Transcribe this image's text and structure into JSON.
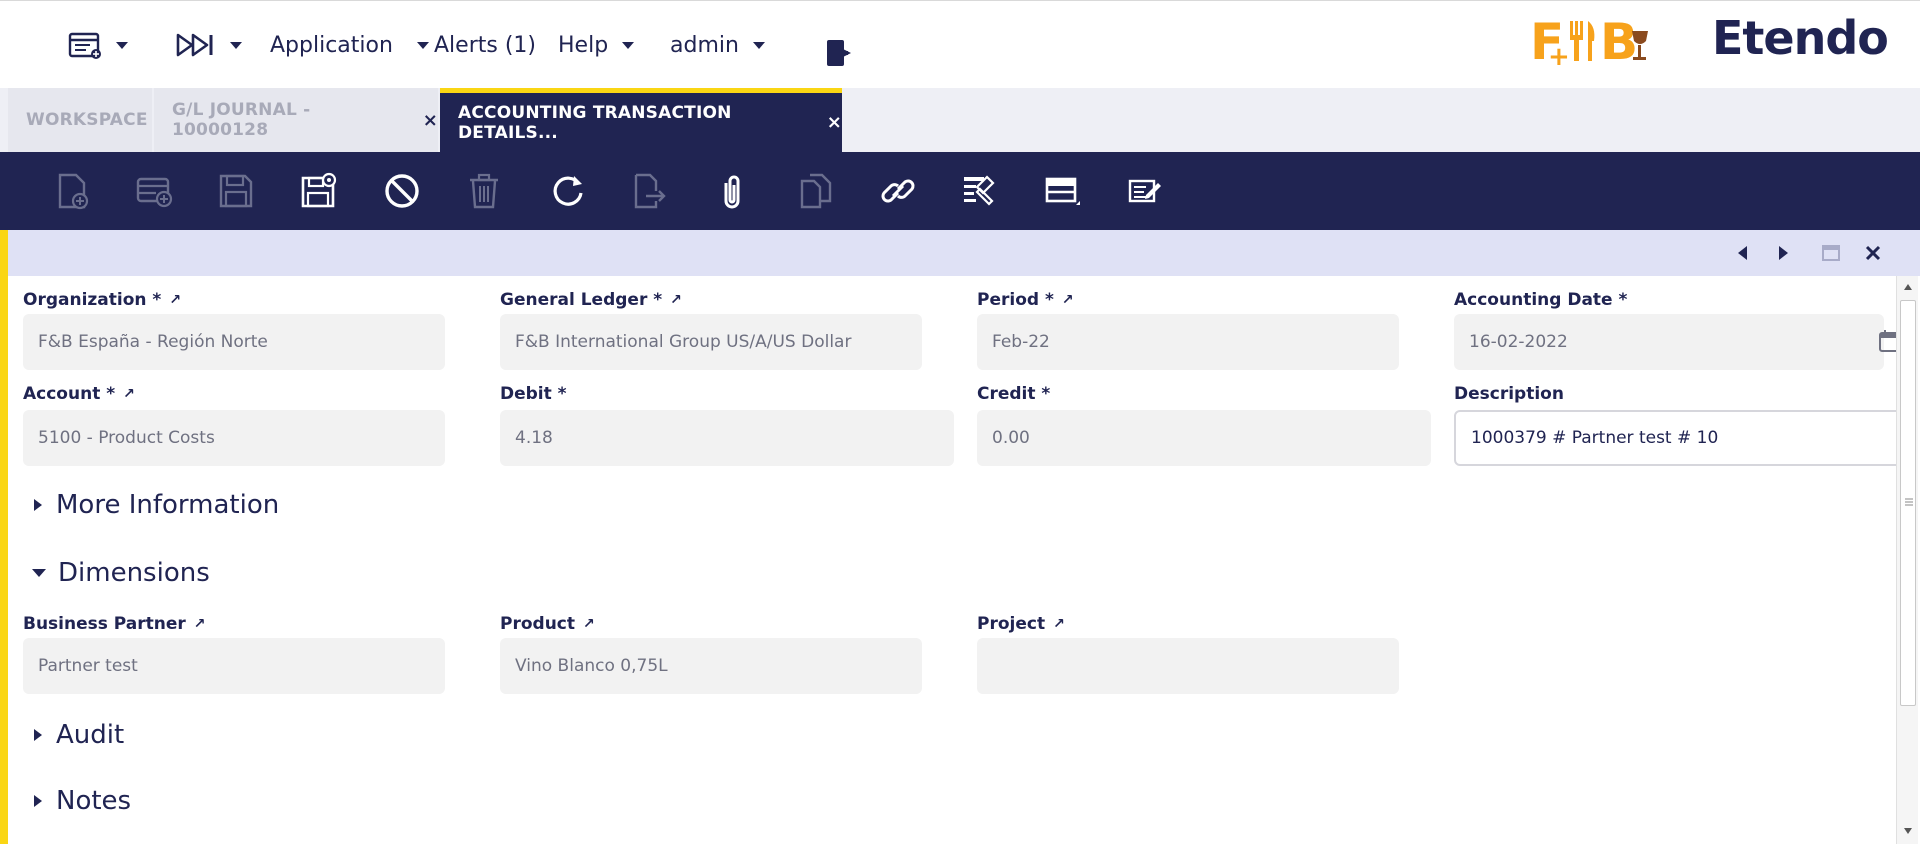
{
  "topnav": {
    "application": "Application",
    "alerts": "Alerts (1)",
    "help": "Help",
    "user": "admin",
    "logo_fb": "F+B",
    "logo_etendo": "Etendo"
  },
  "tabs": [
    {
      "label": "WORKSPACE"
    },
    {
      "label": "G/L JOURNAL - 10000128",
      "close": "×"
    },
    {
      "label": "ACCOUNTING TRANSACTION DETAILS...",
      "close": "×"
    }
  ],
  "form": {
    "organization": {
      "label": "Organization *",
      "value": "F&B España - Región Norte"
    },
    "general_ledger": {
      "label": "General Ledger *",
      "value": "F&B International Group US/A/US Dollar"
    },
    "period": {
      "label": "Period *",
      "value": "Feb-22"
    },
    "accounting_date": {
      "label": "Accounting Date *",
      "value": "16-02-2022"
    },
    "account": {
      "label": "Account *",
      "value": "5100 - Product Costs"
    },
    "debit": {
      "label": "Debit *",
      "value": "4.18"
    },
    "credit": {
      "label": "Credit *",
      "value": "0.00"
    },
    "description": {
      "label": "Description",
      "value": "1000379 # Partner test # 10"
    },
    "business_partner": {
      "label": "Business Partner",
      "value": "Partner test"
    },
    "product": {
      "label": "Product",
      "value": "Vino Blanco 0,75L"
    },
    "project": {
      "label": "Project",
      "value": ""
    }
  },
  "sections": {
    "more_information": "More Information",
    "dimensions": "Dimensions",
    "audit": "Audit",
    "notes": "Notes"
  },
  "icons": {
    "link": "↗"
  }
}
